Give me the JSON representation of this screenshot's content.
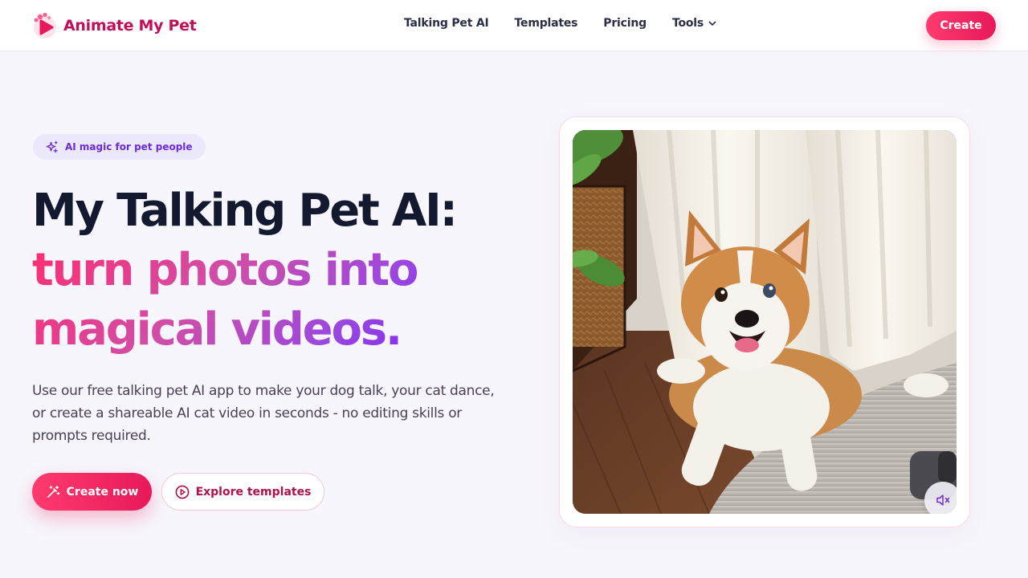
{
  "brand": {
    "name": "Animate My Pet",
    "accent": "#c0105a"
  },
  "nav": {
    "links": [
      {
        "label": "Talking Pet AI"
      },
      {
        "label": "Templates"
      },
      {
        "label": "Pricing"
      },
      {
        "label": "Tools",
        "has_dropdown": true
      }
    ],
    "create_label": "Create"
  },
  "hero": {
    "badge": {
      "text": "AI magic for pet people",
      "icon": "sparkles-icon"
    },
    "headline": {
      "line1": "My Talking Pet AI:",
      "line2": "turn photos into",
      "line3": "magical videos."
    },
    "subtitle": "Use our free talking pet AI app to make your dog talk, your cat dance, or create a shareable AI cat video in seconds - no editing skills or prompts required.",
    "primary_cta": {
      "label": "Create now",
      "icon": "magic-wand-icon"
    },
    "secondary_cta": {
      "label": "Explore templates",
      "icon": "play-circle-icon"
    },
    "media": {
      "subject": "corgi-photo",
      "mute_icon": "speaker-muted-icon",
      "muted": true
    }
  },
  "colors": {
    "primary": "#ee1f60",
    "headline_dark": "#131a30",
    "gradient": [
      "#ff2d6f",
      "#cf4ea8",
      "#9a47e0",
      "#6b1af5"
    ],
    "badge_bg": "#ece8fb",
    "badge_text": "#6b2bd8",
    "page_bg": "#f7f6fc"
  }
}
